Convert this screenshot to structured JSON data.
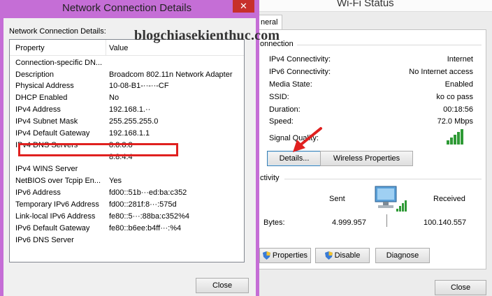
{
  "watermark": "blogchiasekienthuc.com",
  "wifi": {
    "title": "Wi-Fi Status",
    "tab": "neral",
    "connection_heading": "onnection",
    "rows": [
      {
        "label": "IPv4 Connectivity:",
        "value": "Internet"
      },
      {
        "label": "IPv6 Connectivity:",
        "value": "No Internet access"
      },
      {
        "label": "Media State:",
        "value": "Enabled"
      },
      {
        "label": "SSID:",
        "value": "ko co pass"
      },
      {
        "label": "Duration:",
        "value": "00:18:56"
      },
      {
        "label": "Speed:",
        "value": "72.0 Mbps"
      }
    ],
    "signal_label": "Signal Quality:",
    "details_button": "Details...",
    "wireless_button": "Wireless Properties",
    "activity_heading": "ctivity",
    "sent_label": "Sent",
    "received_label": "Received",
    "bytes_label": "Bytes:",
    "bytes_sent": "4.999.957",
    "bytes_received": "100.140.557",
    "properties_button": "Properties",
    "disable_button": "Disable",
    "diagnose_button": "Diagnose",
    "close_button": "Close"
  },
  "details": {
    "title": "Network Connection Details",
    "close_glyph": "✕",
    "list_label": "Network Connection Details:",
    "col_property": "Property",
    "col_value": "Value",
    "rows": [
      {
        "property": "Connection-specific DN...",
        "value": ""
      },
      {
        "property": "Description",
        "value": "Broadcom 802.11n Network Adapter"
      },
      {
        "property": "Physical Address",
        "value": "10-08-B1-··-··-CF"
      },
      {
        "property": "DHCP Enabled",
        "value": "No"
      },
      {
        "property": "IPv4 Address",
        "value": "192.168.1.··"
      },
      {
        "property": "IPv4 Subnet Mask",
        "value": "255.255.255.0"
      },
      {
        "property": "IPv4 Default Gateway",
        "value": "192.168.1.1"
      },
      {
        "property": "IPv4 DNS Servers",
        "value": "8.8.8.8"
      },
      {
        "property": "",
        "value": "8.8.4.4"
      },
      {
        "property": "IPv4 WINS Server",
        "value": ""
      },
      {
        "property": "NetBIOS over Tcpip En...",
        "value": "Yes"
      },
      {
        "property": "IPv6 Address",
        "value": "fd00::51b···ed:ba:c352"
      },
      {
        "property": "Temporary IPv6 Address",
        "value": "fd00::281f:8···:575d"
      },
      {
        "property": "Link-local IPv6 Address",
        "value": "fe80::5···:88ba:c352%4"
      },
      {
        "property": "IPv6 Default Gateway",
        "value": "fe80::b6ee:b4ff···:%4"
      },
      {
        "property": "IPv6 DNS Server",
        "value": ""
      }
    ],
    "close_button": "Close"
  },
  "colors": {
    "details_frame": "#c56ed6",
    "highlight": "#e0201f",
    "signal": "#2f9a36",
    "close_x": "#c7302b"
  }
}
